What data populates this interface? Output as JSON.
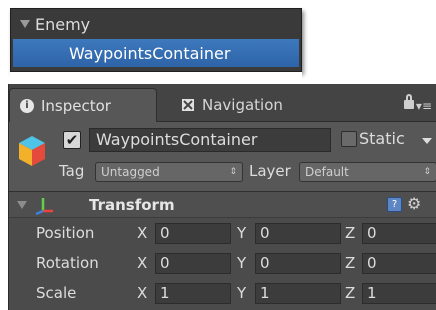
{
  "hierarchy": {
    "parent_label": "Enemy",
    "selected_label": "WaypointsContainer"
  },
  "inspector": {
    "tabs": [
      {
        "label": "Inspector",
        "icon": "info-icon"
      },
      {
        "label": "Navigation",
        "icon": "navigation-icon"
      }
    ],
    "object": {
      "active_check": "✔",
      "name": "WaypointsContainer",
      "static_label": "Static",
      "tag_label": "Tag",
      "tag_value": "Untagged",
      "layer_label": "Layer",
      "layer_value": "Default"
    },
    "transform": {
      "title": "Transform",
      "rows": [
        {
          "label": "Position",
          "x": "0",
          "y": "0",
          "z": "0"
        },
        {
          "label": "Rotation",
          "x": "0",
          "y": "0",
          "z": "0"
        },
        {
          "label": "Scale",
          "x": "1",
          "y": "1",
          "z": "1"
        }
      ],
      "axis_labels": {
        "x": "X",
        "y": "Y",
        "z": "Z"
      }
    }
  },
  "colors": {
    "selection": "#3d78bd",
    "panel": "#4b4b4b"
  }
}
